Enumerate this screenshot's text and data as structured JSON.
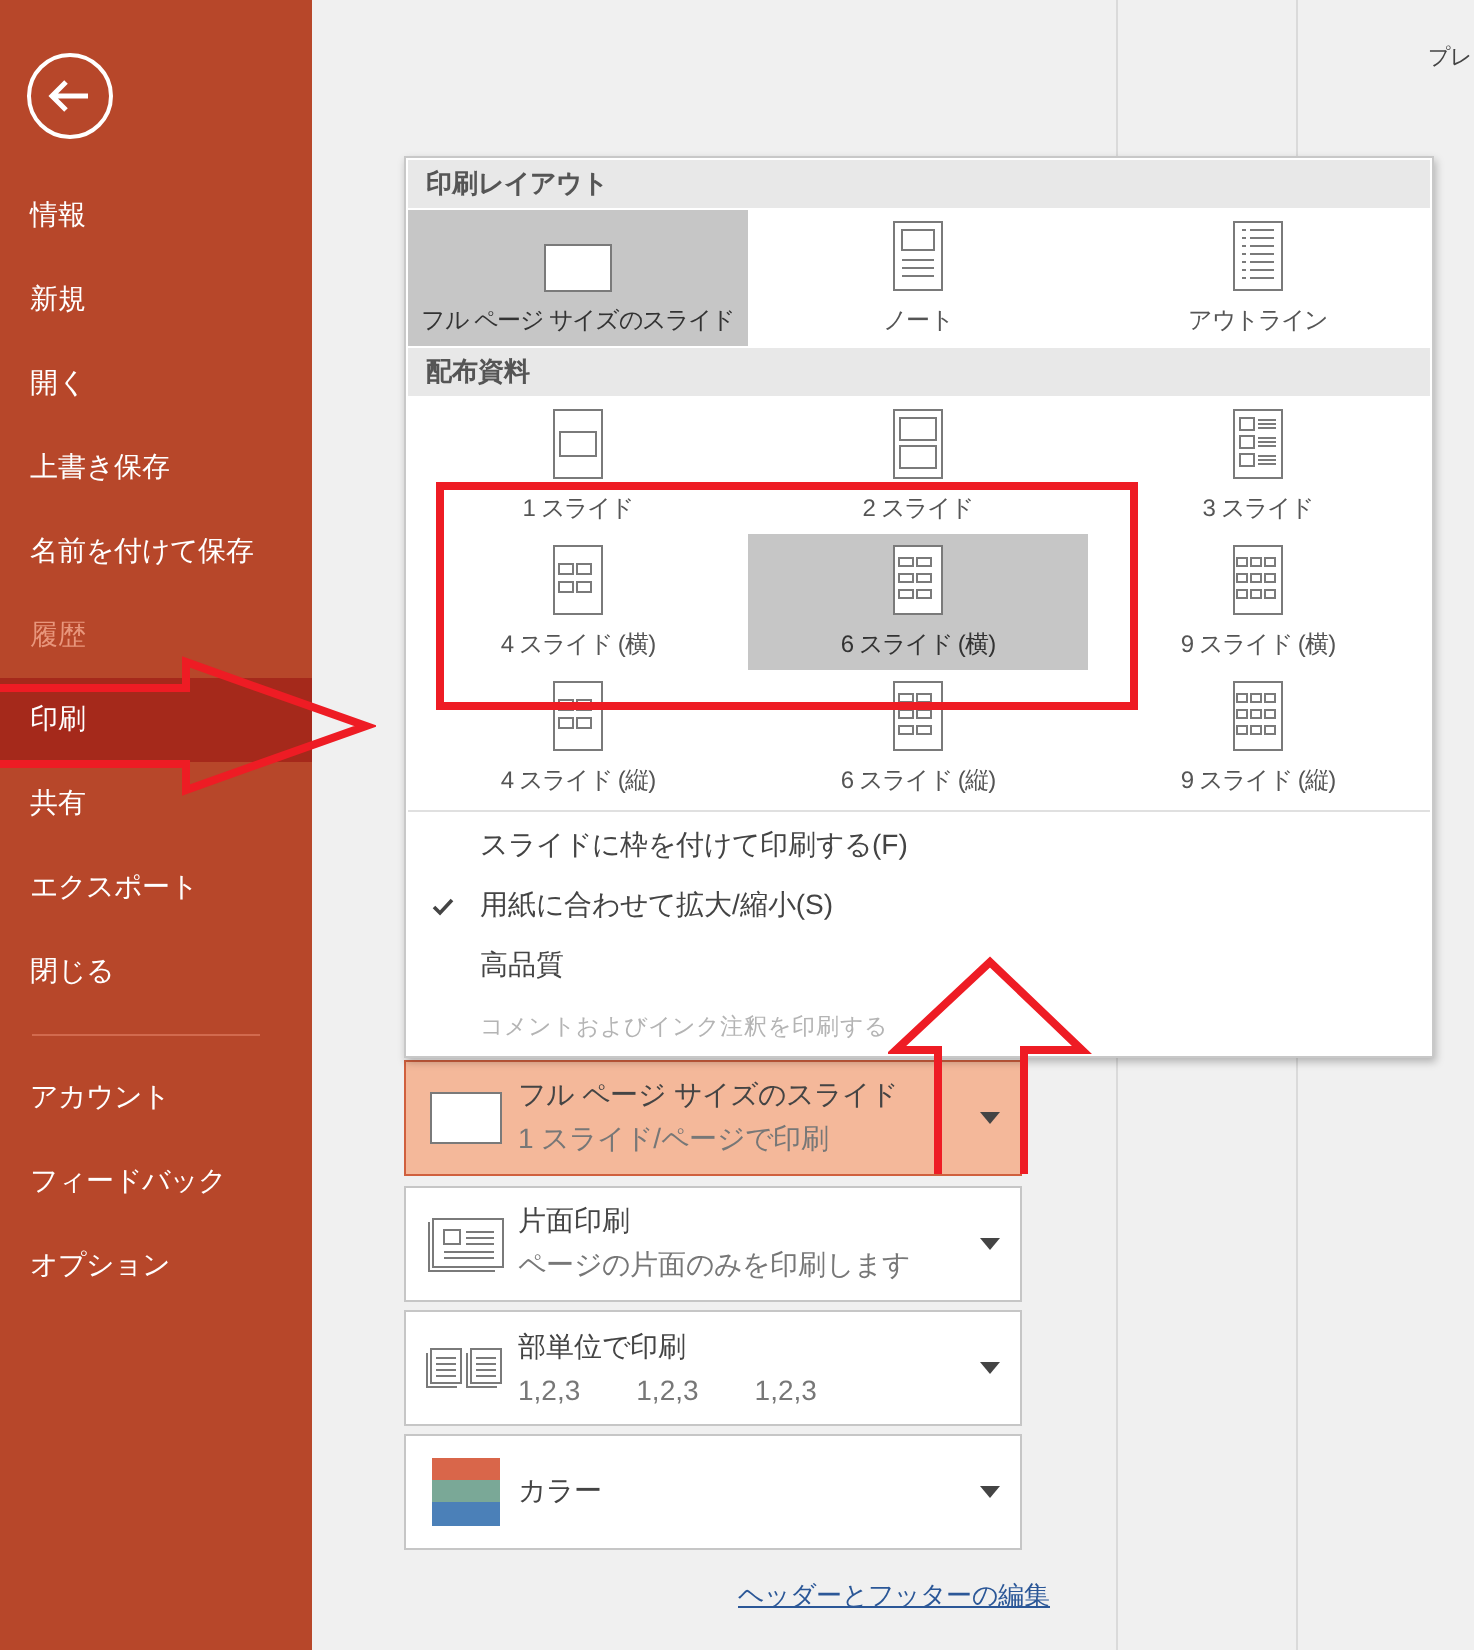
{
  "sidebar": {
    "items": [
      {
        "label": "情報",
        "selected": false,
        "disabled": false
      },
      {
        "label": "新規",
        "selected": false,
        "disabled": false
      },
      {
        "label": "開く",
        "selected": false,
        "disabled": false
      },
      {
        "label": "上書き保存",
        "selected": false,
        "disabled": false
      },
      {
        "label": "名前を付けて保存",
        "selected": false,
        "disabled": false
      },
      {
        "label": "履歴",
        "selected": false,
        "disabled": true
      },
      {
        "label": "印刷",
        "selected": true,
        "disabled": false
      },
      {
        "label": "共有",
        "selected": false,
        "disabled": false
      },
      {
        "label": "エクスポート",
        "selected": false,
        "disabled": false
      },
      {
        "label": "閉じる",
        "selected": false,
        "disabled": false
      }
    ],
    "bottom_items": [
      {
        "label": "アカウント",
        "selected": false,
        "disabled": false
      },
      {
        "label": "フィードバック",
        "selected": false,
        "disabled": false
      },
      {
        "label": "オプション",
        "selected": false,
        "disabled": false
      }
    ]
  },
  "header_text": "プレ",
  "layout_menu": {
    "sections": [
      {
        "title": "印刷レイアウト",
        "items": [
          {
            "label": "フル ページ サイズのスライド",
            "kind": "full-page",
            "selected": true
          },
          {
            "label": "ノート",
            "kind": "notes",
            "selected": false
          },
          {
            "label": "アウトライン",
            "kind": "outline",
            "selected": false
          }
        ]
      },
      {
        "title": "配布資料",
        "items": [
          {
            "label": "1 スライド",
            "kind": "h1",
            "selected": false
          },
          {
            "label": "2 スライド",
            "kind": "h2",
            "selected": false
          },
          {
            "label": "3 スライド",
            "kind": "h3",
            "selected": false
          },
          {
            "label": "4 スライド (横)",
            "kind": "h4",
            "selected": false
          },
          {
            "label": "6 スライド (横)",
            "kind": "h6",
            "selected": true
          },
          {
            "label": "9 スライド (横)",
            "kind": "h9",
            "selected": false
          },
          {
            "label": "4 スライド (縦)",
            "kind": "h4",
            "selected": false
          },
          {
            "label": "6 スライド (縦)",
            "kind": "h6",
            "selected": false
          },
          {
            "label": "9 スライド (縦)",
            "kind": "h9",
            "selected": false
          }
        ]
      }
    ],
    "options": [
      {
        "label": "スライドに枠を付けて印刷する(F)",
        "checked": false,
        "disabled": false
      },
      {
        "label": "用紙に合わせて拡大/縮小(S)",
        "checked": true,
        "disabled": false
      },
      {
        "label": "高品質",
        "checked": false,
        "disabled": false
      },
      {
        "label": "コメントおよびインク注釈を印刷する",
        "checked": false,
        "disabled": true
      }
    ]
  },
  "settings": [
    {
      "kind": "slide",
      "title": "フル ページ サイズのスライド",
      "subtitle": "1 スライド/ページで印刷",
      "highlighted": true
    },
    {
      "kind": "single-sided",
      "title": "片面印刷",
      "subtitle": "ページの片面のみを印刷します",
      "highlighted": false
    },
    {
      "kind": "collate",
      "title": "部単位で印刷",
      "parts": [
        "1,2,3",
        "1,2,3",
        "1,2,3"
      ],
      "highlighted": false
    },
    {
      "kind": "color",
      "title": "カラー",
      "highlighted": false
    }
  ],
  "footer_link": "ヘッダーとフッターの編集"
}
